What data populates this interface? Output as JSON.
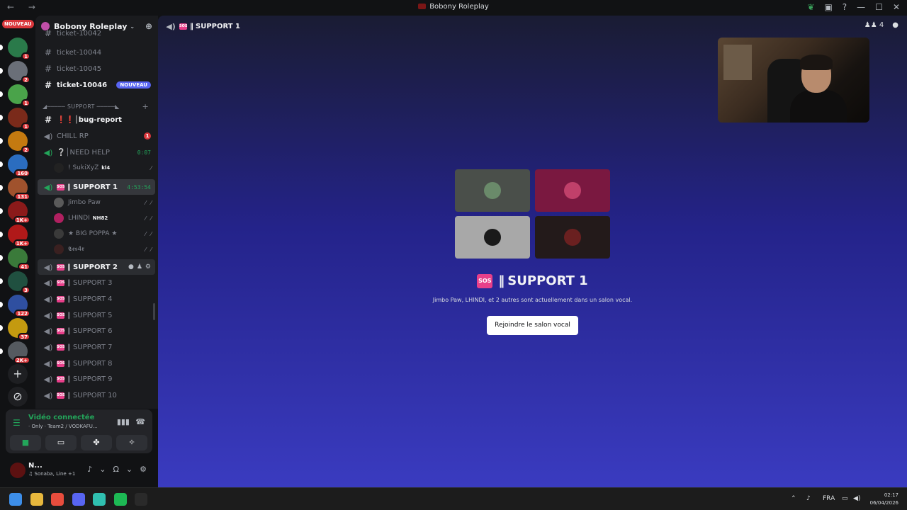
{
  "window": {
    "title": "Bobony Roleplay",
    "nav_glyphs": "← →",
    "controls": [
      "—",
      "☐",
      "✕"
    ]
  },
  "server_rail": {
    "nouveau_label": "NOUVEAU",
    "servers": [
      {
        "color": "#2a7a4a",
        "badge": "1"
      },
      {
        "color": "#6a6f78",
        "badge": "2"
      },
      {
        "color": "#4aa34a",
        "badge": "1"
      },
      {
        "color": "#7a2a1a",
        "badge": "1"
      },
      {
        "color": "#c47a10",
        "badge": "2"
      },
      {
        "color": "#2b6dbf",
        "badge": "160"
      },
      {
        "color": "#a0522d",
        "badge": "131"
      },
      {
        "color": "#8b1a1a",
        "badge": "1K+"
      },
      {
        "color": "#b01919",
        "badge": "1K+"
      },
      {
        "color": "#3a7a3a",
        "badge": "41"
      },
      {
        "color": "#205040",
        "badge": "3"
      },
      {
        "color": "#2f4fa0",
        "badge": "122"
      },
      {
        "color": "#c49a10",
        "badge": "37"
      },
      {
        "color": "#555a60",
        "badge": "2K+"
      }
    ]
  },
  "guild": {
    "name": "Bobony Roleplay",
    "icon_color": "#c04fa8"
  },
  "channels": {
    "partial_top": "ticket-10042",
    "tickets": [
      {
        "name": "ticket-10044",
        "unread": false
      },
      {
        "name": "ticket-10045",
        "unread": false
      },
      {
        "name": "ticket-10046",
        "unread": true,
        "tag": "NOUVEAU"
      }
    ],
    "category": "◢───── SUPPORT ─────◣",
    "bug_report": "❗❗│bug-report",
    "chill": {
      "name": "CHILL RP",
      "badge": "1"
    },
    "need_help": {
      "name": "❔│NEED HELP",
      "timer": "0:07"
    },
    "need_help_member": {
      "name": "! SukiXyZ",
      "tag": "kl4"
    },
    "support1": {
      "name": "SUPPORT 1",
      "timer": "4:53:54"
    },
    "support1_members": [
      {
        "name": "Jimbo Paw",
        "color": "#5a5a5a",
        "tag": ""
      },
      {
        "name": "LHINDI",
        "color": "#b02060",
        "tag": "NH82"
      },
      {
        "name": "★ BIG POPPA ★",
        "color": "#3a3a3a",
        "tag": ""
      },
      {
        "name": "𝕮𝖊𝖘4𝖗",
        "color": "#3a2020",
        "tag": ""
      }
    ],
    "other_supports": [
      "SUPPORT 2",
      "SUPPORT 3",
      "SUPPORT 4",
      "SUPPORT 5",
      "SUPPORT 6",
      "SUPPORT 7",
      "SUPPORT 8",
      "SUPPORT 9",
      "SUPPORT 10"
    ],
    "prefix": "‖",
    "sos": "SOS"
  },
  "voice_panel": {
    "status": "Vidéo connectée",
    "subtitle": "· Only · Team2 / VODKAFU...",
    "buttons": [
      "camera",
      "screen-share",
      "activities",
      "soundboard"
    ]
  },
  "user_panel": {
    "name": "N...",
    "subtitle": "♫ Sonaba, Line +1"
  },
  "main": {
    "header_title": "SUPPORT 1",
    "member_count": "4",
    "center_title": "SUPPORT 1",
    "center_sub": "Jimbo Paw, LHINDI, et 2 autres sont actuellement dans un salon vocal.",
    "join_label": "Rejoindre le salon vocal",
    "tiles": [
      {
        "bg": "#4a4f4a",
        "avatar": "#6a8a6a"
      },
      {
        "bg": "#7a1840",
        "avatar": "#c0406a"
      },
      {
        "bg": "#a8a8a8",
        "avatar": "#1a1a1a"
      },
      {
        "bg": "#231a1a",
        "avatar": "#6a2020"
      }
    ]
  },
  "taskbar": {
    "lang": "FRA",
    "time": "02:17",
    "date": "06/04/2026",
    "apps": [
      {
        "name": "windows",
        "color": "#3d8ee8"
      },
      {
        "name": "explorer",
        "color": "#e8b83d"
      },
      {
        "name": "chrome",
        "color": "#e84d3d"
      },
      {
        "name": "discord",
        "color": "#5865f2"
      },
      {
        "name": "capcut",
        "color": "#30c0b0"
      },
      {
        "name": "spotify",
        "color": "#1db954"
      },
      {
        "name": "obs",
        "color": "#2a2a2a"
      }
    ]
  }
}
